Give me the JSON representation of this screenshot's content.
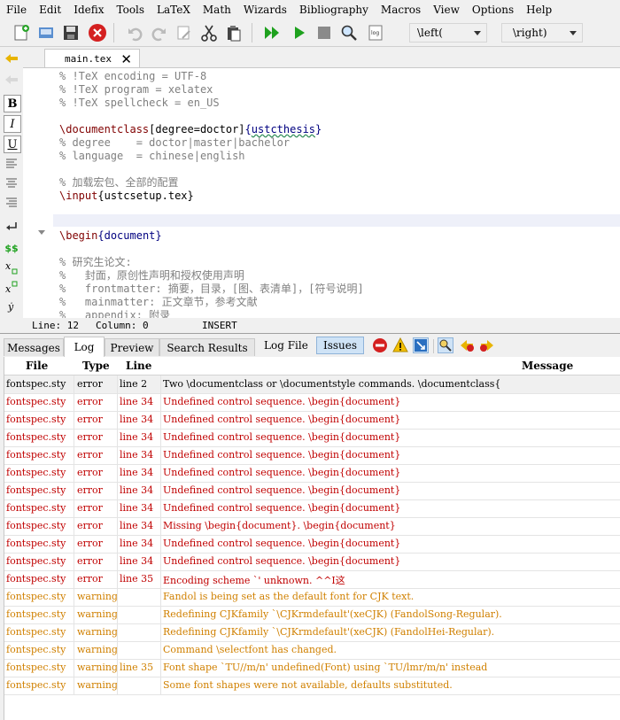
{
  "menu": [
    "File",
    "Edit",
    "Idefix",
    "Tools",
    "LaTeX",
    "Math",
    "Wizards",
    "Bibliography",
    "Macros",
    "View",
    "Options",
    "Help"
  ],
  "toolbar": {
    "left_combo": "\\left(",
    "right_combo": "\\right)"
  },
  "sidebar": {
    "bold": "B",
    "italic": "I",
    "underline": "U",
    "dollars": "$$"
  },
  "editor": {
    "tab_label": "main.tex",
    "lines": [
      {
        "cls": "cm",
        "text": "% !TeX encoding = UTF-8"
      },
      {
        "cls": "cm",
        "text": "% !TeX program = xelatex"
      },
      {
        "cls": "cm",
        "text": "% !TeX spellcheck = en_US"
      },
      {
        "cls": "",
        "text": ""
      },
      {
        "cls": "doccls",
        "text": ""
      },
      {
        "cls": "cm",
        "text": "% degree    = doctor|master|bachelor"
      },
      {
        "cls": "cm",
        "text": "% language  = chinese|english"
      },
      {
        "cls": "",
        "text": ""
      },
      {
        "cls": "cm",
        "text": "% 加载宏包、全部的配置"
      },
      {
        "cls": "input",
        "text": ""
      },
      {
        "cls": "",
        "text": ""
      },
      {
        "cls": "",
        "text": ""
      },
      {
        "cls": "begin",
        "text": ""
      },
      {
        "cls": "",
        "text": ""
      },
      {
        "cls": "cm",
        "text": "% 研究生论文:"
      },
      {
        "cls": "cm",
        "text": "%   封面，原创性声明和授权使用声明"
      },
      {
        "cls": "cm",
        "text": "%   frontmatter: 摘要，目录，[图、表清单]，[符号说明]"
      },
      {
        "cls": "cm",
        "text": "%   mainmatter: 正文章节，参考文献"
      },
      {
        "cls": "cm",
        "text": "%   appendix: 附录"
      }
    ],
    "documentclass": {
      "cmd": "\\documentclass",
      "opt": "[degree=doctor]",
      "arg": "ustcthesis"
    },
    "input": {
      "cmd": "\\input",
      "arg": "ustcsetup.tex"
    },
    "begin": {
      "cmd": "\\begin",
      "arg": "document"
    }
  },
  "status": {
    "line": "Line: 12",
    "column": "Column: 0",
    "mode": "INSERT"
  },
  "panel": {
    "tabs": [
      "Messages",
      "Log",
      "Preview",
      "Search Results"
    ],
    "active_tab": "Log",
    "log_file": "Log File",
    "issues": "Issues"
  },
  "log": {
    "columns": [
      "File",
      "Type",
      "Line",
      "Message"
    ],
    "rows": [
      {
        "file": "fontspec.sty",
        "type": "error",
        "line": "line 2",
        "msg": "Two \\documentclass or \\documentstyle commands. \\documentclass{",
        "color": "#000000",
        "sel": true
      },
      {
        "file": "fontspec.sty",
        "type": "error",
        "line": "line 34",
        "msg": "Undefined control sequence. \\begin{document}",
        "color": "#c00000"
      },
      {
        "file": "fontspec.sty",
        "type": "error",
        "line": "line 34",
        "msg": "Undefined control sequence. \\begin{document}",
        "color": "#c00000"
      },
      {
        "file": "fontspec.sty",
        "type": "error",
        "line": "line 34",
        "msg": "Undefined control sequence. \\begin{document}",
        "color": "#c00000"
      },
      {
        "file": "fontspec.sty",
        "type": "error",
        "line": "line 34",
        "msg": "Undefined control sequence. \\begin{document}",
        "color": "#c00000"
      },
      {
        "file": "fontspec.sty",
        "type": "error",
        "line": "line 34",
        "msg": "Undefined control sequence. \\begin{document}",
        "color": "#c00000"
      },
      {
        "file": "fontspec.sty",
        "type": "error",
        "line": "line 34",
        "msg": "Undefined control sequence. \\begin{document}",
        "color": "#c00000"
      },
      {
        "file": "fontspec.sty",
        "type": "error",
        "line": "line 34",
        "msg": "Undefined control sequence. \\begin{document}",
        "color": "#c00000"
      },
      {
        "file": "fontspec.sty",
        "type": "error",
        "line": "line 34",
        "msg": "Missing \\begin{document}. \\begin{document}",
        "color": "#c00000"
      },
      {
        "file": "fontspec.sty",
        "type": "error",
        "line": "line 34",
        "msg": "Undefined control sequence. \\begin{document}",
        "color": "#c00000"
      },
      {
        "file": "fontspec.sty",
        "type": "error",
        "line": "line 34",
        "msg": "Undefined control sequence. \\begin{document}",
        "color": "#c00000"
      },
      {
        "file": "fontspec.sty",
        "type": "error",
        "line": "line 35",
        "msg": "Encoding scheme `' unknown. ^^I这",
        "color": "#c00000"
      },
      {
        "file": "fontspec.sty",
        "type": "warning",
        "line": "",
        "msg": "Fandol is being set as the default font for CJK text.",
        "color": "#d08000"
      },
      {
        "file": "fontspec.sty",
        "type": "warning",
        "line": "",
        "msg": "Redefining CJKfamily `\\CJKrmdefault'(xeCJK) (FandolSong-Regular).",
        "color": "#d08000"
      },
      {
        "file": "fontspec.sty",
        "type": "warning",
        "line": "",
        "msg": "Redefining CJKfamily `\\CJKrmdefault'(xeCJK) (FandolHei-Regular).",
        "color": "#d08000"
      },
      {
        "file": "fontspec.sty",
        "type": "warning",
        "line": "",
        "msg": "Command \\selectfont has changed.",
        "color": "#d08000"
      },
      {
        "file": "fontspec.sty",
        "type": "warning",
        "line": "line 35",
        "msg": "Font shape `TU//m/n' undefined(Font) using `TU/lmr/m/n' instead",
        "color": "#d08000"
      },
      {
        "file": "fontspec.sty",
        "type": "warning",
        "line": "",
        "msg": "Some font shapes were not available, defaults substituted.",
        "color": "#d08000"
      }
    ]
  }
}
